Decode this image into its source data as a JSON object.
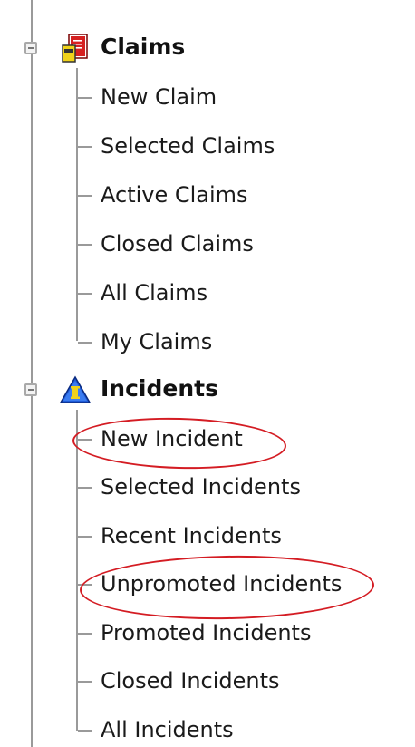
{
  "tree": {
    "groups": [
      {
        "label": "Claims",
        "icon": "claims-icon",
        "items": [
          "New Claim",
          "Selected Claims",
          "Active Claims",
          "Closed Claims",
          "All Claims",
          "My Claims"
        ]
      },
      {
        "label": "Incidents",
        "icon": "incidents-icon",
        "items": [
          "New Incident",
          "Selected Incidents",
          "Recent Incidents",
          "Unpromoted Incidents",
          "Promoted Incidents",
          "Closed Incidents",
          "All Incidents"
        ]
      }
    ]
  },
  "annotations": {
    "highlighted_items": [
      "New Incident",
      "Unpromoted Incidents"
    ],
    "highlight_color": "#d41c23"
  },
  "colors": {
    "tree_line": "#9a9a9a",
    "incidents_icon_blue": "#1e5bd8",
    "claims_icon_red": "#d62020",
    "claims_icon_yellow": "#f0d21a"
  }
}
